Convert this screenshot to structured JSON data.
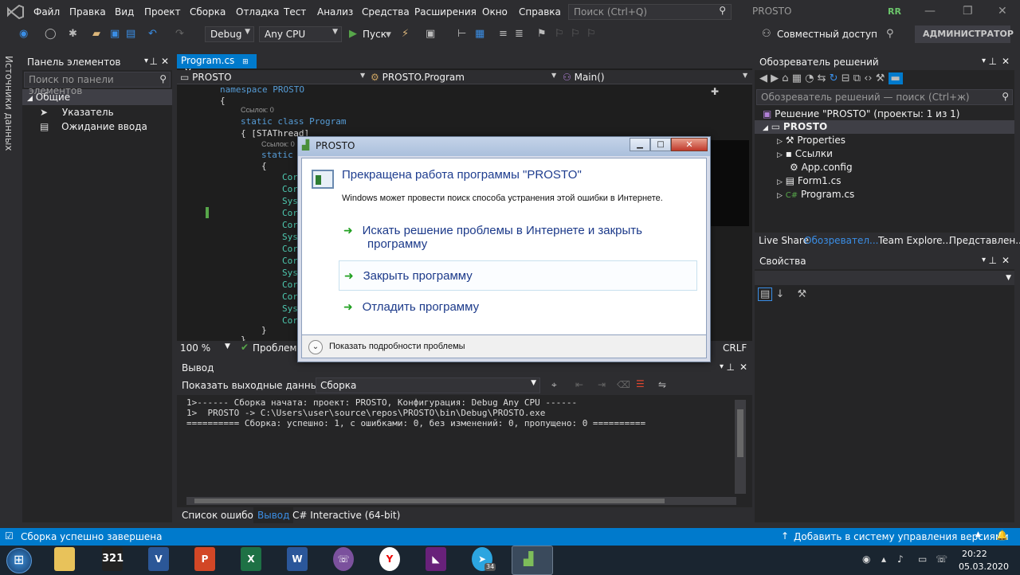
{
  "menu": {
    "items": [
      "Файл",
      "Правка",
      "Вид",
      "Проект",
      "Сборка",
      "Отладка",
      "Тест",
      "Анализ",
      "Средства",
      "Расширения",
      "Окно",
      "Справка"
    ],
    "search_placeholder": "Поиск (Ctrl+Q)",
    "project_name": "PROSTO",
    "user_initials": "RR"
  },
  "toolbar": {
    "config": "Debug",
    "platform": "Any CPU",
    "run_label": "Пуск",
    "share_label": "Совместный доступ",
    "admin_label": "АДМИНИСТРАТОР"
  },
  "left_strip": {
    "label": "Источники данных"
  },
  "toolbox": {
    "title": "Панель элементов",
    "search_placeholder": "Поиск по панели элементов",
    "group": "Общие",
    "items": [
      "Указатель",
      "Ожидание ввода"
    ]
  },
  "editor": {
    "tab_label": "Program.cs",
    "nav_project": "PROSTO",
    "nav_class": "PROSTO.Program",
    "nav_member": "Main()",
    "zoom": "100 %",
    "problems_label": "Проблемы",
    "eol": "CRLF",
    "ref_label": "Ссылок: 0",
    "lines": [
      "namespace PROSTO",
      "{",
      "static class Program",
      "{ [STAThread]",
      "static",
      "{",
      "Cor",
      "Cor",
      "Sys",
      "Cor",
      "Cor",
      "Sys",
      "Cor",
      "Cor",
      "Sys",
      "Cor",
      "Cor",
      "Sys",
      "Cor",
      "}",
      "}"
    ]
  },
  "solution_explorer": {
    "title": "Обозреватель решений",
    "search_placeholder": "Обозреватель решений — поиск (Ctrl+ж)",
    "solution": "Решение \"PROSTO\" (проекты: 1 из 1)",
    "project": "PROSTO",
    "items": [
      "Properties",
      "Ссылки",
      "App.config",
      "Form1.cs",
      "Program.cs"
    ],
    "tabs": [
      "Live Share",
      "Обозревател...",
      "Team Explore...",
      "Представлен..."
    ]
  },
  "properties": {
    "title": "Свойства"
  },
  "output": {
    "title": "Вывод",
    "show_from_label": "Показать выходные данные из:",
    "source": "Сборка",
    "lines": [
      "1>------ Сборка начата: проект: PROSTO, Конфигурация: Debug Any CPU ------",
      "1>  PROSTO -> C:\\Users\\user\\source\\repos\\PROSTO\\bin\\Debug\\PROSTO.exe",
      "========== Сборка: успешно: 1, с ошибками: 0, без изменений: 0, пропущено: 0 =========="
    ],
    "tabs": [
      "Список ошибок",
      "Вывод",
      "C# Interactive (64-bit)"
    ]
  },
  "status": {
    "message": "Сборка успешно завершена",
    "vcs": "Добавить в систему управления версиями"
  },
  "dialog": {
    "title": "PROSTO",
    "heading": "Прекращена работа программы \"PROSTO\"",
    "subtext": "Windows может провести поиск способа устранения этой ошибки в Интернете.",
    "option1_line1": "Искать решение проблемы в Интернете и закрыть",
    "option1_line2": "программу",
    "option2": "Закрыть программу",
    "option3": "Отладить программу",
    "details": "Показать подробности проблемы"
  },
  "taskbar": {
    "time": "20:22",
    "date": "05.03.2020",
    "telegram_badge": "34"
  },
  "colors": {
    "accent": "#007acc",
    "editor_bg": "#1e1e1e",
    "dialog_link": "#1c3a8a"
  }
}
